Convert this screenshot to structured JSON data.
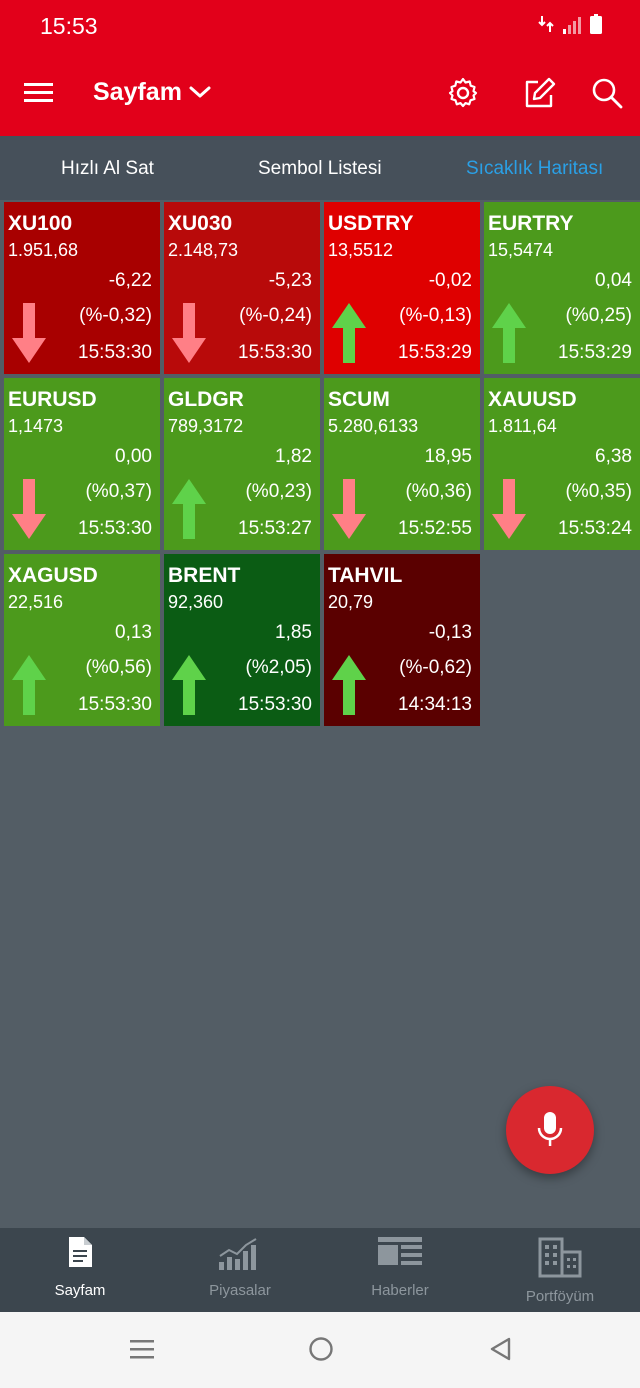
{
  "status": {
    "time": "15:53"
  },
  "header": {
    "title": "Sayfam"
  },
  "tabs": [
    {
      "label": "Hızlı Al Sat",
      "active": false
    },
    {
      "label": "Sembol Listesi",
      "active": false
    },
    {
      "label": "Sıcaklık Haritası",
      "active": true
    }
  ],
  "tiles": [
    {
      "symbol": "XU100",
      "price": "1.951,68",
      "change": "-6,22",
      "pct": "(%-0,32)",
      "time": "15:53:30",
      "dir": "down",
      "bg": "#a80000"
    },
    {
      "symbol": "XU030",
      "price": "2.148,73",
      "change": "-5,23",
      "pct": "(%-0,24)",
      "time": "15:53:30",
      "dir": "down",
      "bg": "#b80a0a"
    },
    {
      "symbol": "USDTRY",
      "price": "13,5512",
      "change": "-0,02",
      "pct": "(%-0,13)",
      "time": "15:53:29",
      "dir": "up",
      "bg": "#df0000"
    },
    {
      "symbol": "EURTRY",
      "price": "15,5474",
      "change": "0,04",
      "pct": "(%0,25)",
      "time": "15:53:29",
      "dir": "up",
      "bg": "#4c9a1c"
    },
    {
      "symbol": "EURUSD",
      "price": "1,1473",
      "change": "0,00",
      "pct": "(%0,37)",
      "time": "15:53:30",
      "dir": "down",
      "bg": "#4c9a1c"
    },
    {
      "symbol": "GLDGR",
      "price": "789,3172",
      "change": "1,82",
      "pct": "(%0,23)",
      "time": "15:53:27",
      "dir": "up",
      "bg": "#4c9a1c"
    },
    {
      "symbol": "SCUM",
      "price": "5.280,6133",
      "change": "18,95",
      "pct": "(%0,36)",
      "time": "15:52:55",
      "dir": "down",
      "bg": "#4c9a1c"
    },
    {
      "symbol": "XAUUSD",
      "price": "1.811,64",
      "change": "6,38",
      "pct": "(%0,35)",
      "time": "15:53:24",
      "dir": "down",
      "bg": "#4c9a1c"
    },
    {
      "symbol": "XAGUSD",
      "price": "22,516",
      "change": "0,13",
      "pct": "(%0,56)",
      "time": "15:53:30",
      "dir": "up",
      "bg": "#4c9a1c"
    },
    {
      "symbol": "BRENT",
      "price": "92,360",
      "change": "1,85",
      "pct": "(%2,05)",
      "time": "15:53:30",
      "dir": "up",
      "bg": "#0b5c14"
    },
    {
      "symbol": "TAHVIL",
      "price": "20,79",
      "change": "-0,13",
      "pct": "(%-0,62)",
      "time": "14:34:13",
      "dir": "up",
      "bg": "#5a0000"
    }
  ],
  "arrow_colors": {
    "up": "#5fd24a",
    "down": "#ff7f86"
  },
  "bottom_nav": [
    {
      "label": "Sayfam",
      "icon": "document-icon",
      "active": true
    },
    {
      "label": "Piyasalar",
      "icon": "chart-icon",
      "active": false
    },
    {
      "label": "Haberler",
      "icon": "news-icon",
      "active": false
    },
    {
      "label": "Portföyüm",
      "icon": "buildings-icon",
      "active": false
    }
  ]
}
